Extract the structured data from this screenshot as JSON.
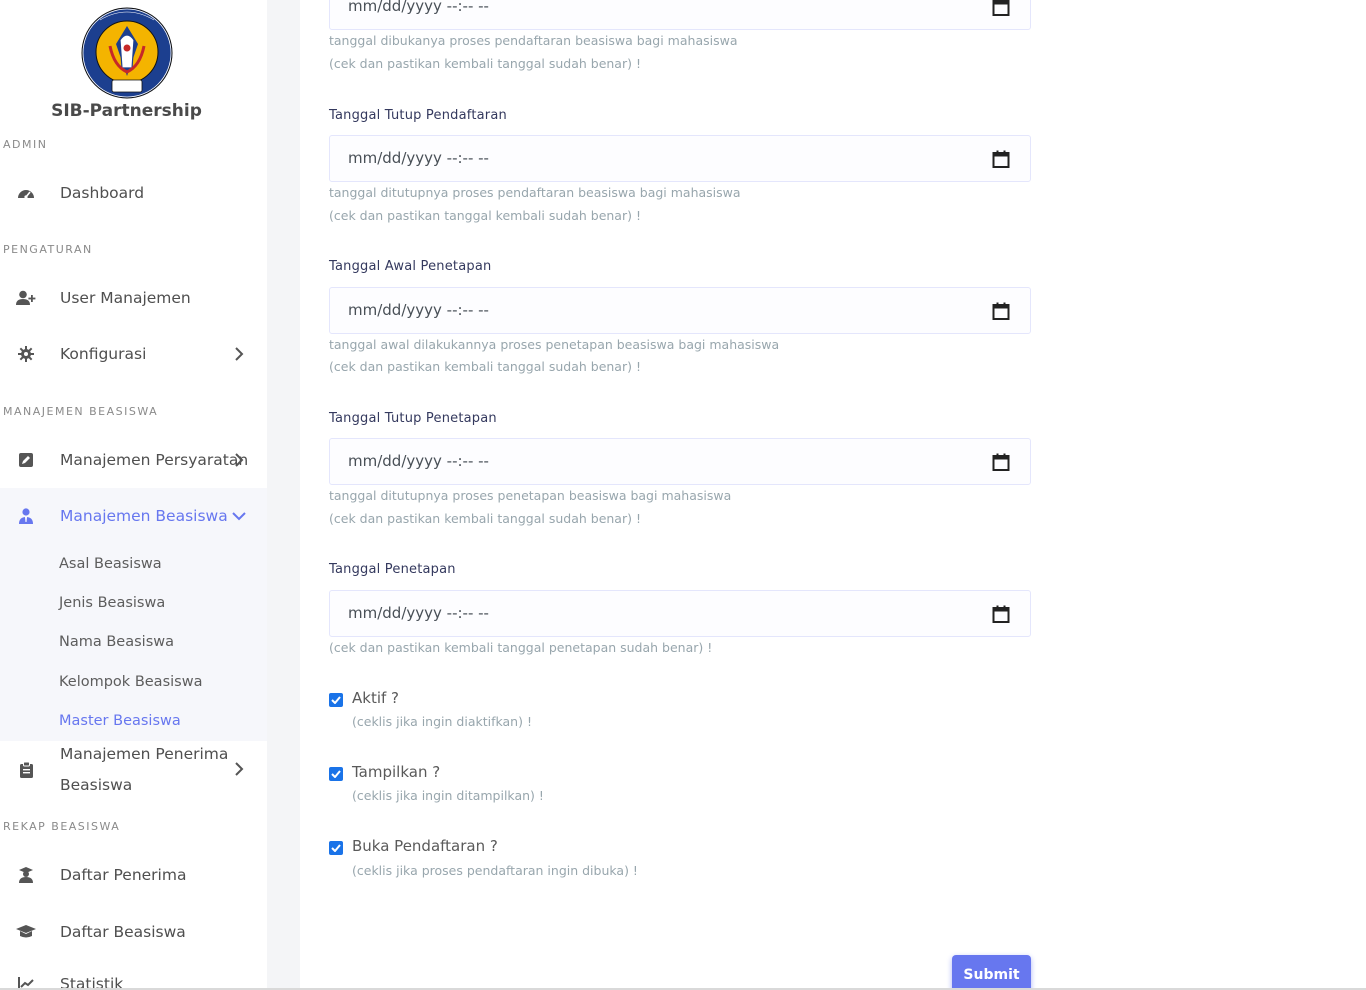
{
  "brand": {
    "name": "SIB-Partnership",
    "logo_text": "UNP",
    "logo_ring_text": "UNIVERSITAS NEGERI PADANG"
  },
  "sidebar": {
    "sections": {
      "admin": "ADMIN",
      "pengaturan": "PENGATURAN",
      "manajemen_beasiswa": "MANAJEMEN BEASISWA",
      "rekap_beasiswa": "REKAP BEASISWA"
    },
    "items": {
      "dashboard": "Dashboard",
      "user_manajemen": "User Manajemen",
      "konfigurasi": "Konfigurasi",
      "manajemen_persyaratan": "Manajemen Persyaratan",
      "manajemen_beasiswa": "Manajemen Beasiswa",
      "manajemen_penerima_line1": "Manajemen Penerima",
      "manajemen_penerima_line2": "Beasiswa",
      "daftar_penerima": "Daftar Penerima",
      "daftar_beasiswa": "Daftar Beasiswa",
      "statistik": "Statistik"
    },
    "submenu": {
      "asal": "Asal Beasiswa",
      "jenis": "Jenis Beasiswa",
      "nama": "Nama Beasiswa",
      "kelompok": "Kelompok Beasiswa",
      "master": "Master Beasiswa"
    }
  },
  "form": {
    "date_placeholder": "mm/dd/yyyy --:-- --",
    "buka": {
      "help1": "tanggal dibukanya proses pendaftaran beasiswa bagi mahasiswa",
      "help2": "(cek dan pastikan kembali tanggal sudah benar) !"
    },
    "tutup_pendaftaran": {
      "label": "Tanggal Tutup Pendaftaran",
      "help1": "tanggal ditutupnya proses pendaftaran beasiswa bagi mahasiswa",
      "help2": "(cek dan pastikan tanggal kembali sudah benar) !"
    },
    "awal_penetapan": {
      "label": "Tanggal Awal Penetapan",
      "help1": "tanggal awal dilakukannya proses penetapan beasiswa bagi mahasiswa",
      "help2": "(cek dan pastikan kembali tanggal sudah benar) !"
    },
    "tutup_penetapan": {
      "label": "Tanggal Tutup Penetapan",
      "help1": "tanggal ditutupnya proses penetapan beasiswa bagi mahasiswa",
      "help2": "(cek dan pastikan kembali tanggal sudah benar) !"
    },
    "penetapan": {
      "label": "Tanggal Penetapan",
      "help1": "(cek dan pastikan kembali tanggal penetapan sudah benar) !"
    },
    "aktif": {
      "label": "Aktif ?",
      "help": "(ceklis jika ingin diaktifkan) !",
      "checked": true
    },
    "tampilkan": {
      "label": "Tampilkan ?",
      "help": "(ceklis jika ingin ditampilkan) !",
      "checked": true
    },
    "buka_pendaftaran": {
      "label": "Buka Pendaftaran ?",
      "help": "(ceklis jika proses pendaftaran ingin dibuka) !",
      "checked": true
    },
    "submit": "Submit"
  },
  "colors": {
    "accent": "#6777ef",
    "checkbox": "#1a73e8",
    "help_text": "#98a6ad"
  }
}
